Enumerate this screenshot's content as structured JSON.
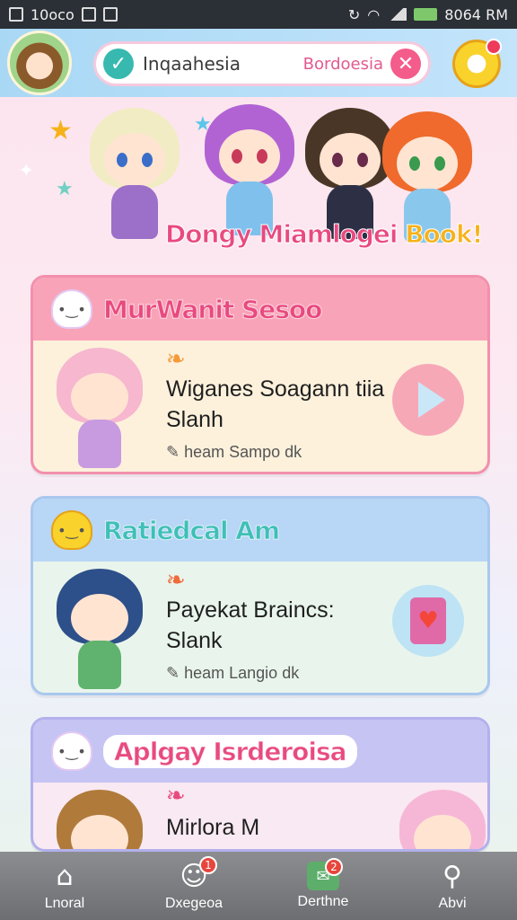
{
  "status_bar": {
    "left_text": "10oco",
    "time": "8064 RM"
  },
  "header": {
    "search_value": "Inqaahesia",
    "search_tag": "Bordoesia"
  },
  "hero": {
    "title_main": "Dongy Miamlogei",
    "title_book": "Book!"
  },
  "cards": [
    {
      "title": "MurWanit Sesoo",
      "line1": "Wiganes Soagann tiia",
      "line2": "Slanh",
      "meta": "heam Sampo dk",
      "color_head": "#f9a3b8",
      "color_title": "#e84a7f",
      "color_body": "#fdf1dc"
    },
    {
      "title": "Ratiedcal Am",
      "line1": "Payekat Braincs:",
      "line2": "Slank",
      "meta": "heam Langio dk",
      "color_head": "#b8d6f5",
      "color_title": "#3fbfb8",
      "color_body": "#e9f5ec"
    },
    {
      "title": "Aplgay Isrderoisa",
      "line1": "Mirlora M",
      "color_head": "#c6c4f3",
      "color_title": "#e84a7f",
      "color_body": "#f8e9f2"
    }
  ],
  "bottom_nav": [
    {
      "label": "Lnoral",
      "icon": "home-icon"
    },
    {
      "label": "Dxegeoa",
      "icon": "mascot-icon",
      "badge": "1"
    },
    {
      "label": "Derthne",
      "icon": "chat-icon",
      "badge": "2"
    },
    {
      "label": "Abvi",
      "icon": "search-icon"
    }
  ]
}
